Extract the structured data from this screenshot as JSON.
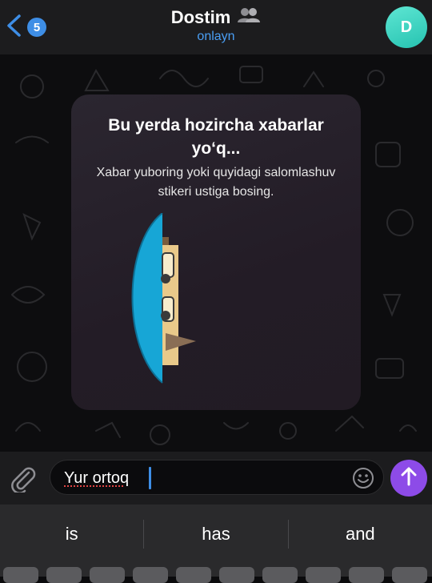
{
  "header": {
    "back_count": "5",
    "title": "Dostim",
    "status": "onlayn",
    "avatar_letter": "D"
  },
  "empty_state": {
    "title": "Bu yerda hozircha xabarlar yo‘q...",
    "subtitle": "Xabar yuboring yoki quyidagi salomlashuv stikeri ustiga bosing."
  },
  "composer": {
    "text": "Yur ortoq"
  },
  "keyboard": {
    "suggestions": [
      "is",
      "has",
      "and"
    ]
  },
  "colors": {
    "accent": "#3e8ee6",
    "send": "#8d4be8",
    "avatar": "#26c3b1",
    "status": "#4a9ff5"
  }
}
